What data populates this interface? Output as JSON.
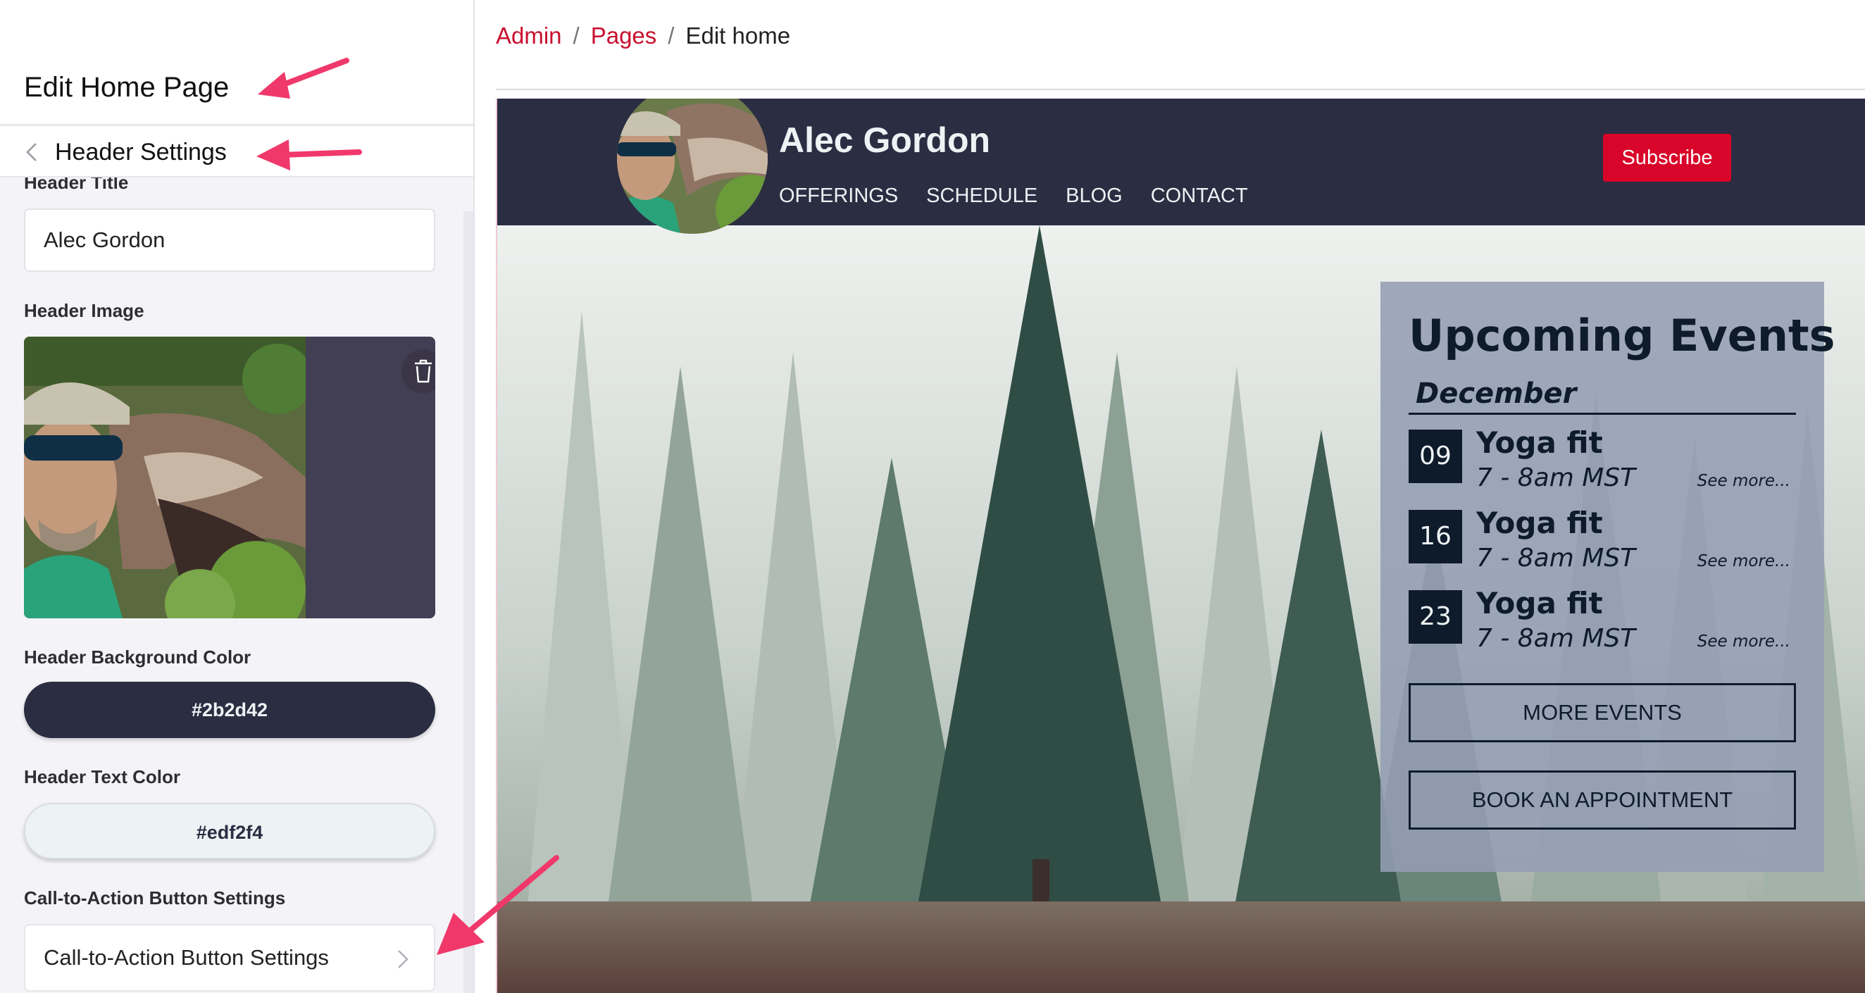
{
  "sidebar": {
    "title": "Edit Home Page",
    "section_label": "Header Settings",
    "header_title_label": "Header Title",
    "header_title_value": "Alec Gordon",
    "header_image_label": "Header Image",
    "bg_color_label": "Header Background Color",
    "bg_color_value": "#2b2d42",
    "text_color_label": "Header Text Color",
    "text_color_value": "#edf2f4",
    "cta_label": "Call-to-Action Button Settings",
    "cta_row_label": "Call-to-Action Button Settings"
  },
  "breadcrumb": {
    "items": [
      "Admin",
      "Pages"
    ],
    "current": "Edit home",
    "separator": "/"
  },
  "site": {
    "title": "Alec Gordon",
    "nav": [
      "OFFERINGS",
      "SCHEDULE",
      "BLOG",
      "CONTACT"
    ],
    "subscribe_label": "Subscribe"
  },
  "events": {
    "title": "Upcoming Events",
    "month": "December",
    "items": [
      {
        "day": "09",
        "name": "Yoga fit",
        "time": "7 - 8am MST",
        "more": "See more..."
      },
      {
        "day": "16",
        "name": "Yoga fit",
        "time": "7 - 8am MST",
        "more": "See more..."
      },
      {
        "day": "23",
        "name": "Yoga fit",
        "time": "7 - 8am MST",
        "more": "See more..."
      }
    ],
    "more_events_label": "MORE EVENTS",
    "book_label": "BOOK AN APPOINTMENT"
  },
  "colors": {
    "header_bg": "#2b2d42",
    "header_text": "#edf2f4",
    "accent": "#d90429",
    "link": "#c8102e",
    "annotation_arrow": "#f0386b"
  },
  "icons": [
    "chevron-left-icon",
    "trash-icon",
    "chevron-right-icon",
    "annotation-arrow-icon"
  ]
}
